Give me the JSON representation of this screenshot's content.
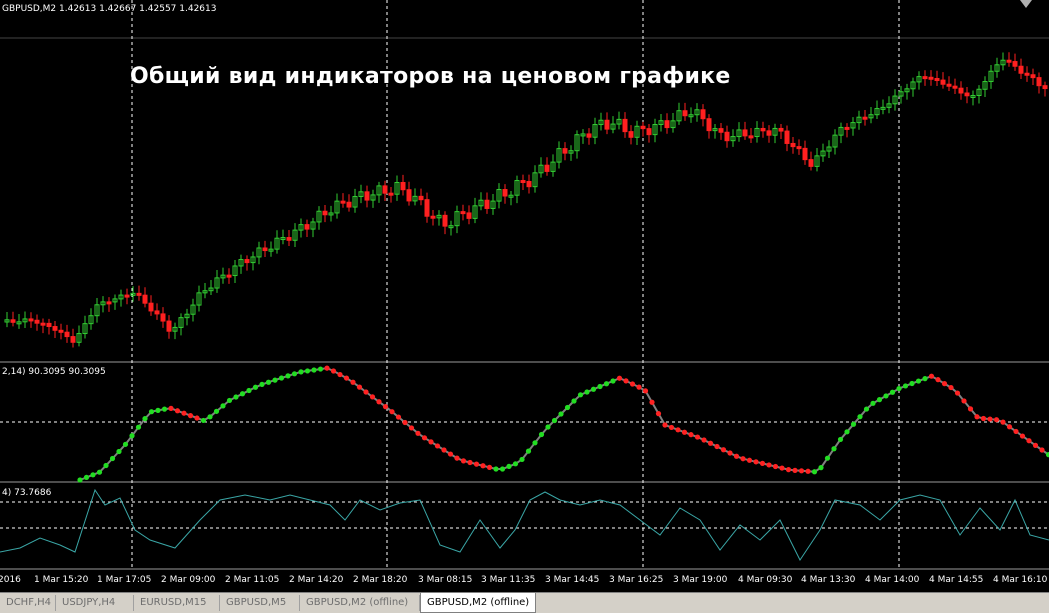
{
  "window": {
    "main_header": "GBPUSD,M2  1.42613 1.42667 1.42557 1.42613",
    "title_overlay": "Общий вид индикаторов на ценовом графике"
  },
  "indicator1": {
    "header": "2,14) 90.3095 90.3095"
  },
  "indicator2": {
    "header": "4) 73.7686"
  },
  "time_axis": {
    "labels": [
      "2016",
      "1 Mar 15:20",
      "1 Mar 17:05",
      "2 Mar 09:00",
      "2 Mar 11:05",
      "2 Mar 14:20",
      "2 Mar 18:20",
      "3 Mar 08:15",
      "3 Mar 11:35",
      "3 Mar 14:45",
      "3 Mar 16:25",
      "3 Mar 19:00",
      "4 Mar 09:30",
      "4 Mar 13:30",
      "4 Mar 14:00",
      "4 Mar 14:55",
      "4 Mar 16:10"
    ]
  },
  "tabs": [
    {
      "label": "DCHF,H4",
      "active": false
    },
    {
      "label": "USDJPY,H4",
      "active": false
    },
    {
      "label": "EURUSD,M15",
      "active": false
    },
    {
      "label": "GBPUSD,M5",
      "active": false
    },
    {
      "label": "GBPUSD,M2 (offline)",
      "active": false
    },
    {
      "label": "GBPUSD,M2 (offline)",
      "active": true
    }
  ],
  "colors": {
    "background": "#000000",
    "bull_candle": "#32cd32",
    "bear_candle": "#ff2020",
    "oscillator_up": "#22dd22",
    "oscillator_down": "#ff2222",
    "rsi_line": "#3aa6a6",
    "grid": "#ffffff",
    "separator": "#9a9a9a"
  }
}
